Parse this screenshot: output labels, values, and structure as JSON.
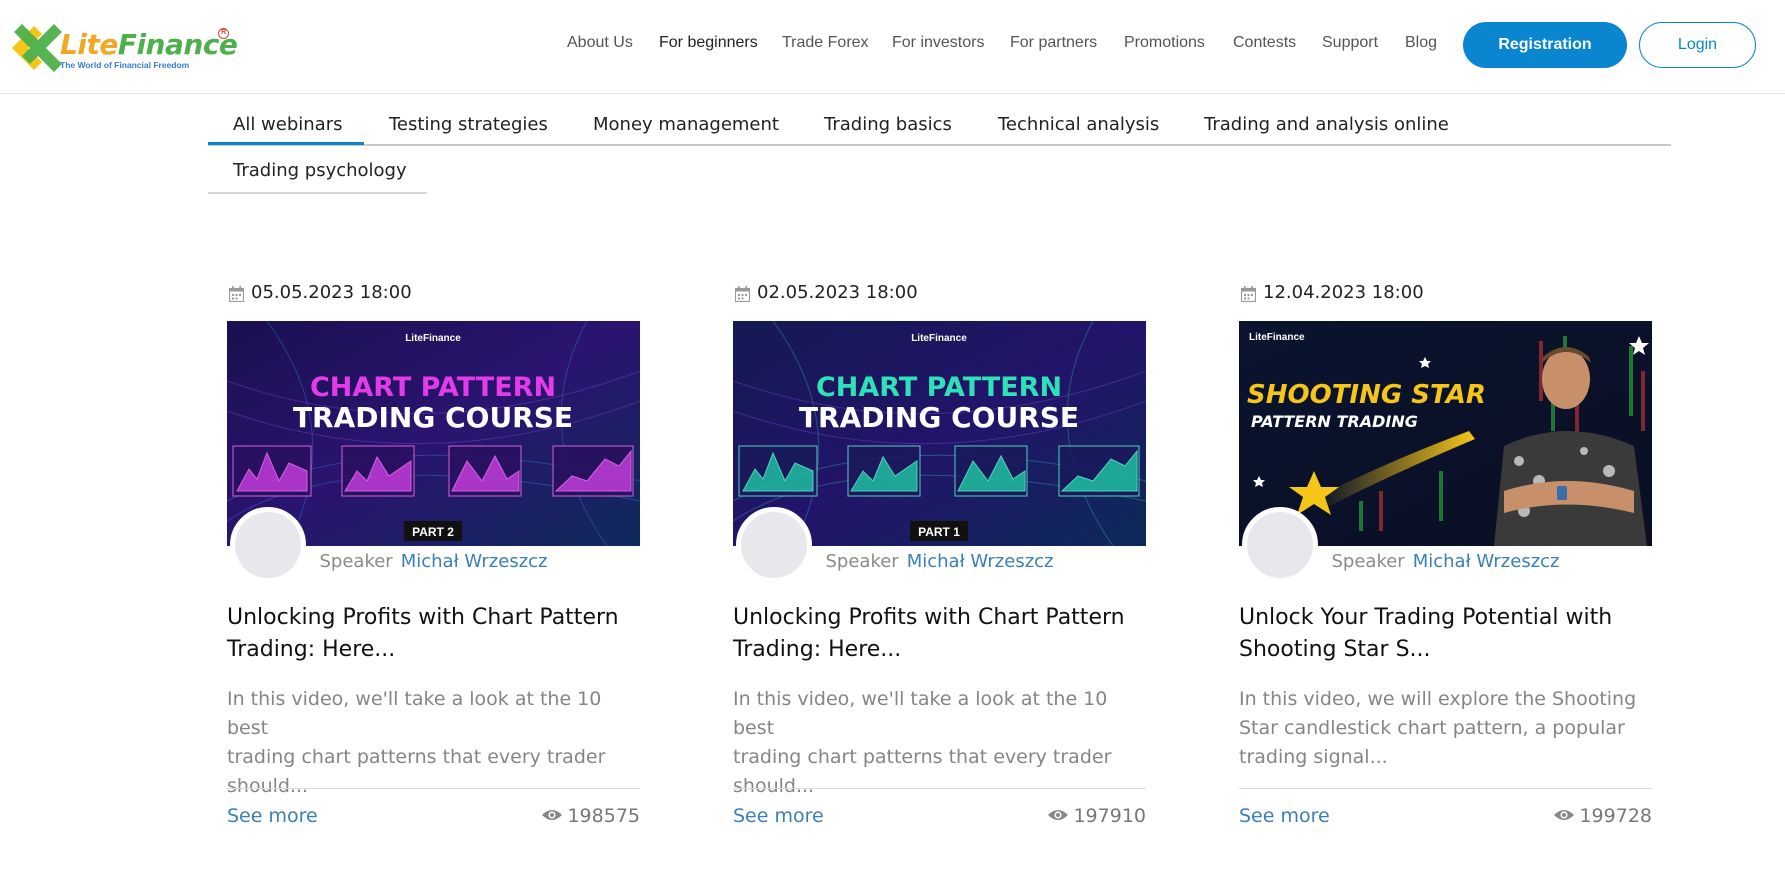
{
  "header": {
    "logo": {
      "lite": "Lite",
      "finance": "Finance",
      "tagline": "The World of Financial Freedom",
      "reg_mark": "R"
    },
    "nav": [
      {
        "label": "About Us"
      },
      {
        "label": "For beginners"
      },
      {
        "label": "Trade Forex"
      },
      {
        "label": "For investors"
      },
      {
        "label": "For partners"
      },
      {
        "label": "Promotions"
      },
      {
        "label": "Contests"
      },
      {
        "label": "Support"
      },
      {
        "label": "Blog"
      }
    ],
    "registration_label": "Registration",
    "login_label": "Login"
  },
  "tabs": [
    {
      "label": "All webinars",
      "active": true
    },
    {
      "label": "Testing strategies"
    },
    {
      "label": "Money management"
    },
    {
      "label": "Trading basics"
    },
    {
      "label": "Technical analysis"
    },
    {
      "label": "Trading and analysis online"
    },
    {
      "label": "Trading psychology"
    }
  ],
  "cards": [
    {
      "date": "05.05.2023 18:00",
      "thumb": {
        "brand": "LiteFinance",
        "line1": "CHART PATTERN",
        "line2": "TRADING COURSE",
        "part": "PART 2",
        "accent": "#e23be8"
      },
      "speaker_label": "Speaker",
      "speaker_name": "Michał Wrzeszcz",
      "title_line1": "Unlocking Profits with Chart Pattern",
      "title_line2": "Trading: Here...",
      "desc_line1": "In this video, we'll take a look at the 10 best",
      "desc_line2": "trading chart patterns that every trader",
      "desc_line3": "should...",
      "see_more": "See more",
      "views": "198575"
    },
    {
      "date": "02.05.2023 18:00",
      "thumb": {
        "brand": "LiteFinance",
        "line1": "CHART PATTERN",
        "line2": "TRADING COURSE",
        "part": "PART 1",
        "accent": "#2fe0b8"
      },
      "speaker_label": "Speaker",
      "speaker_name": "Michał Wrzeszcz",
      "title_line1": "Unlocking Profits with Chart Pattern",
      "title_line2": "Trading: Here...",
      "desc_line1": "In this video, we'll take a look at the 10 best",
      "desc_line2": "trading chart patterns that every trader",
      "desc_line3": "should...",
      "see_more": "See more",
      "views": "197910"
    },
    {
      "date": "12.04.2023 18:00",
      "thumb": {
        "brand": "LiteFinance",
        "line1": "SHOOTING STAR",
        "line2": "PATTERN TRADING",
        "accent": "#f5c518"
      },
      "speaker_label": "Speaker",
      "speaker_name": "Michał Wrzeszcz",
      "title_line1": "Unlock Your Trading Potential with",
      "title_line2": "Shooting Star S...",
      "desc_line1": "In this video, we will explore the Shooting",
      "desc_line2": "Star candlestick chart pattern, a popular",
      "desc_line3": "trading signal...",
      "see_more": "See more",
      "views": "199728"
    }
  ],
  "colors": {
    "brand_blue": "#0a86d0",
    "link_blue": "#3a7fb8",
    "logo_orange": "#f5a623",
    "logo_green": "#4db04a"
  }
}
